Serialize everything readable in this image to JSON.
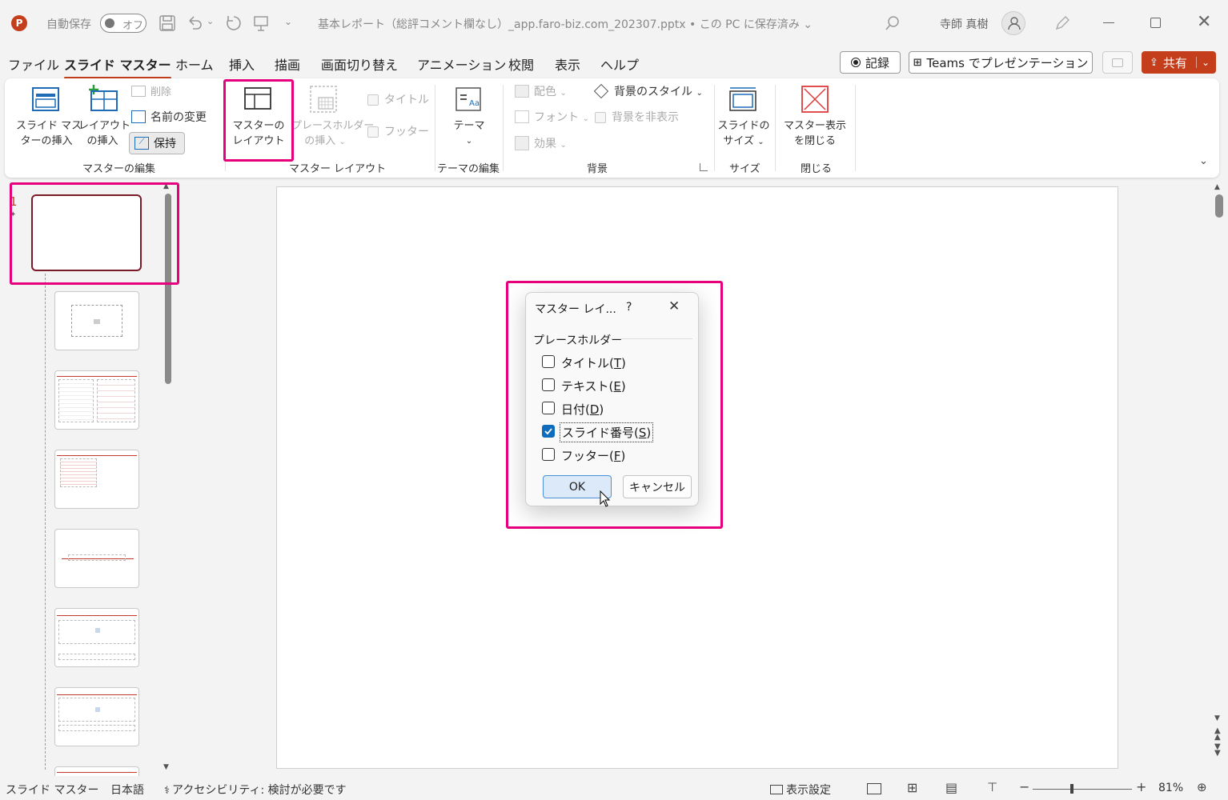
{
  "titlebar": {
    "autosave_label": "自動保存",
    "autosave_state": "オフ",
    "filename": "基本レポート（総評コメント欄なし）_app.faro-biz.com_202307.pptx • この PC に保存済み",
    "user_name": "寺師 真樹"
  },
  "menu": {
    "tabs": [
      "ファイル",
      "スライド マスター",
      "ホーム",
      "挿入",
      "描画",
      "画面切り替え",
      "アニメーション",
      "校閲",
      "表示",
      "ヘルプ"
    ],
    "record_label": "記録",
    "teams_label": "Teams でプレゼンテーション",
    "share_label": "共有"
  },
  "ribbon": {
    "insert_master_l1": "スライド マス",
    "insert_master_l2": "ターの挿入",
    "insert_layout_l1": "レイアウト",
    "insert_layout_l2": "の挿入",
    "delete": "削除",
    "rename": "名前の変更",
    "preserve": "保持",
    "group_master_edit": "マスターの編集",
    "master_layout_l1": "マスターの",
    "master_layout_l2": "レイアウト",
    "insert_placeholder_l1": "プレースホルダー",
    "insert_placeholder_l2": "の挿入",
    "title_check": "タイトル",
    "footer_check": "フッター",
    "group_master_layout": "マスター レイアウト",
    "theme": "テーマ",
    "group_theme_edit": "テーマの編集",
    "colors": "配色",
    "fonts": "フォント",
    "effects": "効果",
    "bg_styles": "背景のスタイル",
    "hide_bg": "背景を非表示",
    "group_background": "背景",
    "slide_size_l1": "スライドの",
    "slide_size_l2": "サイズ",
    "group_size": "サイズ",
    "close_master_l1": "マスター表示",
    "close_master_l2": "を閉じる",
    "group_close": "閉じる"
  },
  "slides": {
    "first_number": "1"
  },
  "dialog": {
    "title": "マスター レイ...",
    "help": "?",
    "section": "プレースホルダー",
    "items": [
      {
        "label": "タイトル(",
        "key": "T",
        "end": ")",
        "checked": false
      },
      {
        "label": "テキスト(",
        "key": "E",
        "end": ")",
        "checked": false
      },
      {
        "label": "日付(",
        "key": "D",
        "end": ")",
        "checked": false
      },
      {
        "label": "スライド番号(",
        "key": "S",
        "end": ")",
        "checked": true
      },
      {
        "label": "フッター(",
        "key": "F",
        "end": ")",
        "checked": false
      }
    ],
    "ok": "OK",
    "cancel": "キャンセル"
  },
  "status": {
    "view": "スライド マスター",
    "language": "日本語",
    "accessibility": "アクセシビリティ: 検討が必要です",
    "display_settings": "表示設定",
    "zoom": "81%"
  },
  "colors": {
    "accent": "#c43e1c",
    "highlight": "#e6007e",
    "checkbox_on": "#0f6cbd"
  }
}
